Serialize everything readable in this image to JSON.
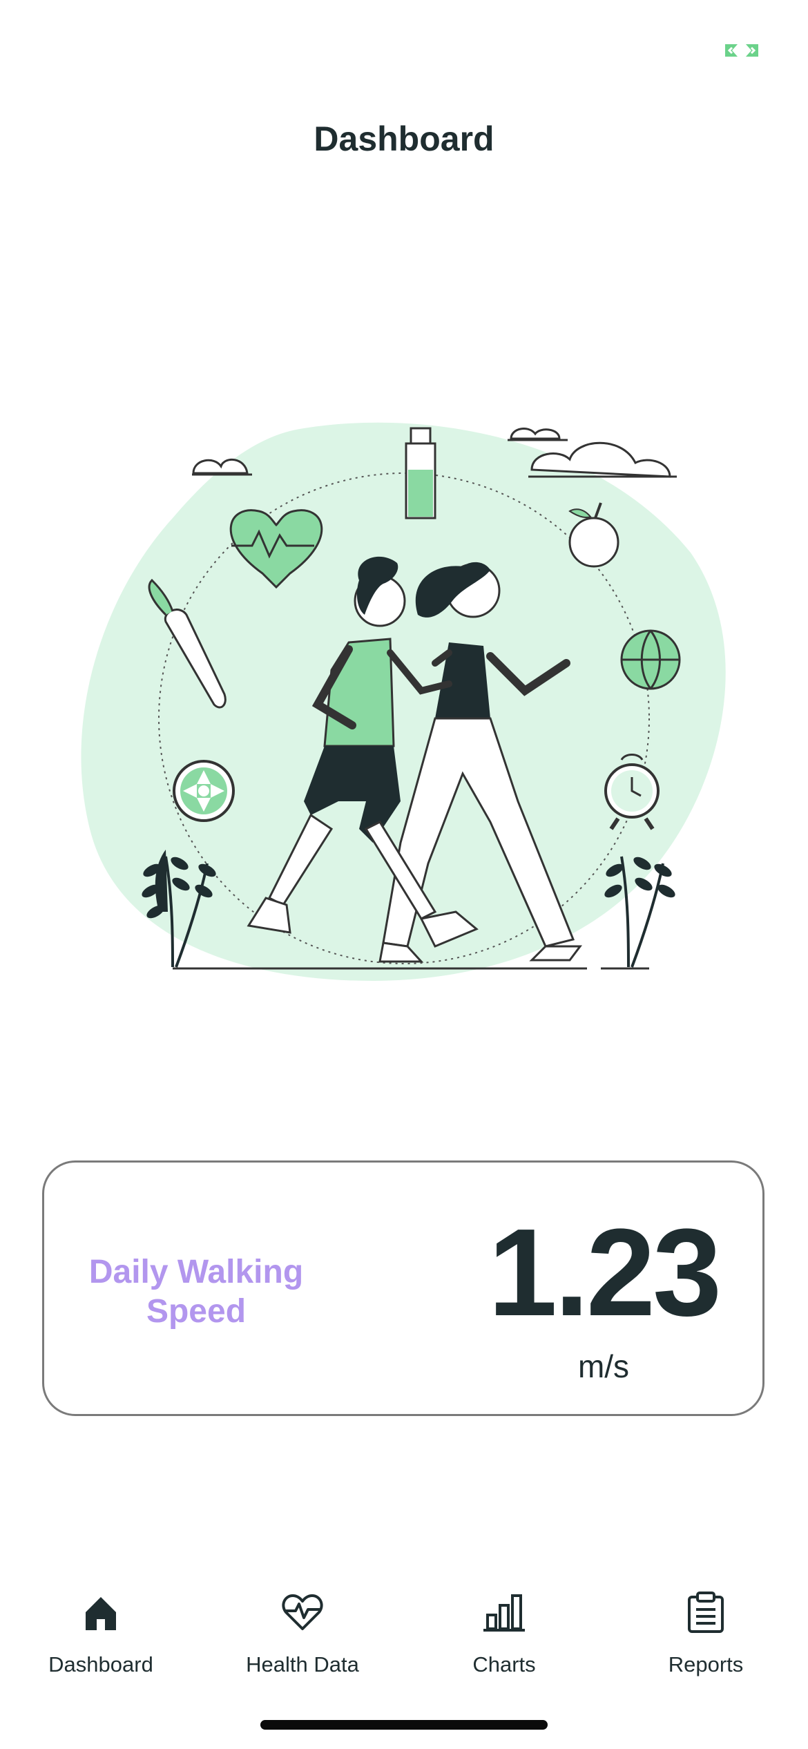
{
  "colors": {
    "accent": "#6bd28a",
    "label_purple": "#b296ee",
    "text_dark": "#1f2d30",
    "blob_mint": "#dcf5e6",
    "card_border": "#7a7a7a"
  },
  "status": {
    "icon": "expand-arrows-icon"
  },
  "header": {
    "title": "Dashboard"
  },
  "illustration": {
    "icon": "walking-couple-illustration"
  },
  "metric_card": {
    "label": "Daily Walking Speed",
    "value": "1.23",
    "unit": "m/s"
  },
  "tabbar": {
    "tabs": [
      {
        "label": "Dashboard",
        "icon": "home-icon",
        "active": true
      },
      {
        "label": "Health Data",
        "icon": "heart-pulse-icon",
        "active": false
      },
      {
        "label": "Charts",
        "icon": "bar-chart-icon",
        "active": false
      },
      {
        "label": "Reports",
        "icon": "clipboard-icon",
        "active": false
      }
    ]
  }
}
